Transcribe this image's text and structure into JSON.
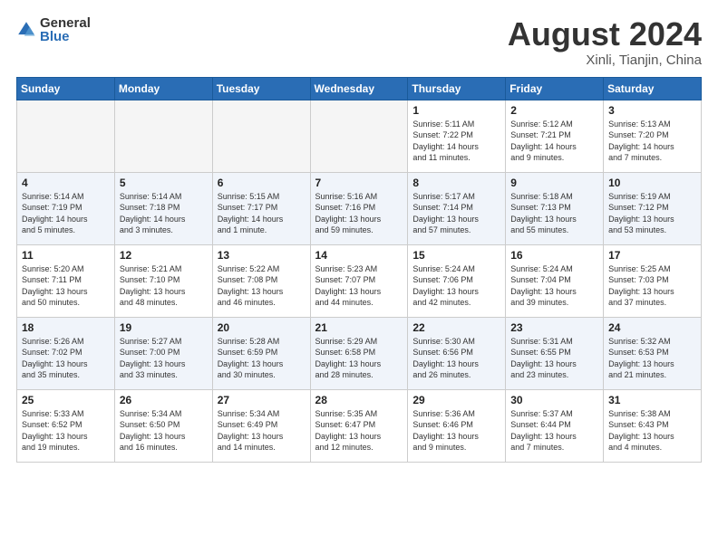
{
  "header": {
    "logo_general": "General",
    "logo_blue": "Blue",
    "month": "August 2024",
    "location": "Xinli, Tianjin, China"
  },
  "weekdays": [
    "Sunday",
    "Monday",
    "Tuesday",
    "Wednesday",
    "Thursday",
    "Friday",
    "Saturday"
  ],
  "weeks": [
    [
      {
        "day": "",
        "info": ""
      },
      {
        "day": "",
        "info": ""
      },
      {
        "day": "",
        "info": ""
      },
      {
        "day": "",
        "info": ""
      },
      {
        "day": "1",
        "info": "Sunrise: 5:11 AM\nSunset: 7:22 PM\nDaylight: 14 hours\nand 11 minutes."
      },
      {
        "day": "2",
        "info": "Sunrise: 5:12 AM\nSunset: 7:21 PM\nDaylight: 14 hours\nand 9 minutes."
      },
      {
        "day": "3",
        "info": "Sunrise: 5:13 AM\nSunset: 7:20 PM\nDaylight: 14 hours\nand 7 minutes."
      }
    ],
    [
      {
        "day": "4",
        "info": "Sunrise: 5:14 AM\nSunset: 7:19 PM\nDaylight: 14 hours\nand 5 minutes."
      },
      {
        "day": "5",
        "info": "Sunrise: 5:14 AM\nSunset: 7:18 PM\nDaylight: 14 hours\nand 3 minutes."
      },
      {
        "day": "6",
        "info": "Sunrise: 5:15 AM\nSunset: 7:17 PM\nDaylight: 14 hours\nand 1 minute."
      },
      {
        "day": "7",
        "info": "Sunrise: 5:16 AM\nSunset: 7:16 PM\nDaylight: 13 hours\nand 59 minutes."
      },
      {
        "day": "8",
        "info": "Sunrise: 5:17 AM\nSunset: 7:14 PM\nDaylight: 13 hours\nand 57 minutes."
      },
      {
        "day": "9",
        "info": "Sunrise: 5:18 AM\nSunset: 7:13 PM\nDaylight: 13 hours\nand 55 minutes."
      },
      {
        "day": "10",
        "info": "Sunrise: 5:19 AM\nSunset: 7:12 PM\nDaylight: 13 hours\nand 53 minutes."
      }
    ],
    [
      {
        "day": "11",
        "info": "Sunrise: 5:20 AM\nSunset: 7:11 PM\nDaylight: 13 hours\nand 50 minutes."
      },
      {
        "day": "12",
        "info": "Sunrise: 5:21 AM\nSunset: 7:10 PM\nDaylight: 13 hours\nand 48 minutes."
      },
      {
        "day": "13",
        "info": "Sunrise: 5:22 AM\nSunset: 7:08 PM\nDaylight: 13 hours\nand 46 minutes."
      },
      {
        "day": "14",
        "info": "Sunrise: 5:23 AM\nSunset: 7:07 PM\nDaylight: 13 hours\nand 44 minutes."
      },
      {
        "day": "15",
        "info": "Sunrise: 5:24 AM\nSunset: 7:06 PM\nDaylight: 13 hours\nand 42 minutes."
      },
      {
        "day": "16",
        "info": "Sunrise: 5:24 AM\nSunset: 7:04 PM\nDaylight: 13 hours\nand 39 minutes."
      },
      {
        "day": "17",
        "info": "Sunrise: 5:25 AM\nSunset: 7:03 PM\nDaylight: 13 hours\nand 37 minutes."
      }
    ],
    [
      {
        "day": "18",
        "info": "Sunrise: 5:26 AM\nSunset: 7:02 PM\nDaylight: 13 hours\nand 35 minutes."
      },
      {
        "day": "19",
        "info": "Sunrise: 5:27 AM\nSunset: 7:00 PM\nDaylight: 13 hours\nand 33 minutes."
      },
      {
        "day": "20",
        "info": "Sunrise: 5:28 AM\nSunset: 6:59 PM\nDaylight: 13 hours\nand 30 minutes."
      },
      {
        "day": "21",
        "info": "Sunrise: 5:29 AM\nSunset: 6:58 PM\nDaylight: 13 hours\nand 28 minutes."
      },
      {
        "day": "22",
        "info": "Sunrise: 5:30 AM\nSunset: 6:56 PM\nDaylight: 13 hours\nand 26 minutes."
      },
      {
        "day": "23",
        "info": "Sunrise: 5:31 AM\nSunset: 6:55 PM\nDaylight: 13 hours\nand 23 minutes."
      },
      {
        "day": "24",
        "info": "Sunrise: 5:32 AM\nSunset: 6:53 PM\nDaylight: 13 hours\nand 21 minutes."
      }
    ],
    [
      {
        "day": "25",
        "info": "Sunrise: 5:33 AM\nSunset: 6:52 PM\nDaylight: 13 hours\nand 19 minutes."
      },
      {
        "day": "26",
        "info": "Sunrise: 5:34 AM\nSunset: 6:50 PM\nDaylight: 13 hours\nand 16 minutes."
      },
      {
        "day": "27",
        "info": "Sunrise: 5:34 AM\nSunset: 6:49 PM\nDaylight: 13 hours\nand 14 minutes."
      },
      {
        "day": "28",
        "info": "Sunrise: 5:35 AM\nSunset: 6:47 PM\nDaylight: 13 hours\nand 12 minutes."
      },
      {
        "day": "29",
        "info": "Sunrise: 5:36 AM\nSunset: 6:46 PM\nDaylight: 13 hours\nand 9 minutes."
      },
      {
        "day": "30",
        "info": "Sunrise: 5:37 AM\nSunset: 6:44 PM\nDaylight: 13 hours\nand 7 minutes."
      },
      {
        "day": "31",
        "info": "Sunrise: 5:38 AM\nSunset: 6:43 PM\nDaylight: 13 hours\nand 4 minutes."
      }
    ]
  ]
}
